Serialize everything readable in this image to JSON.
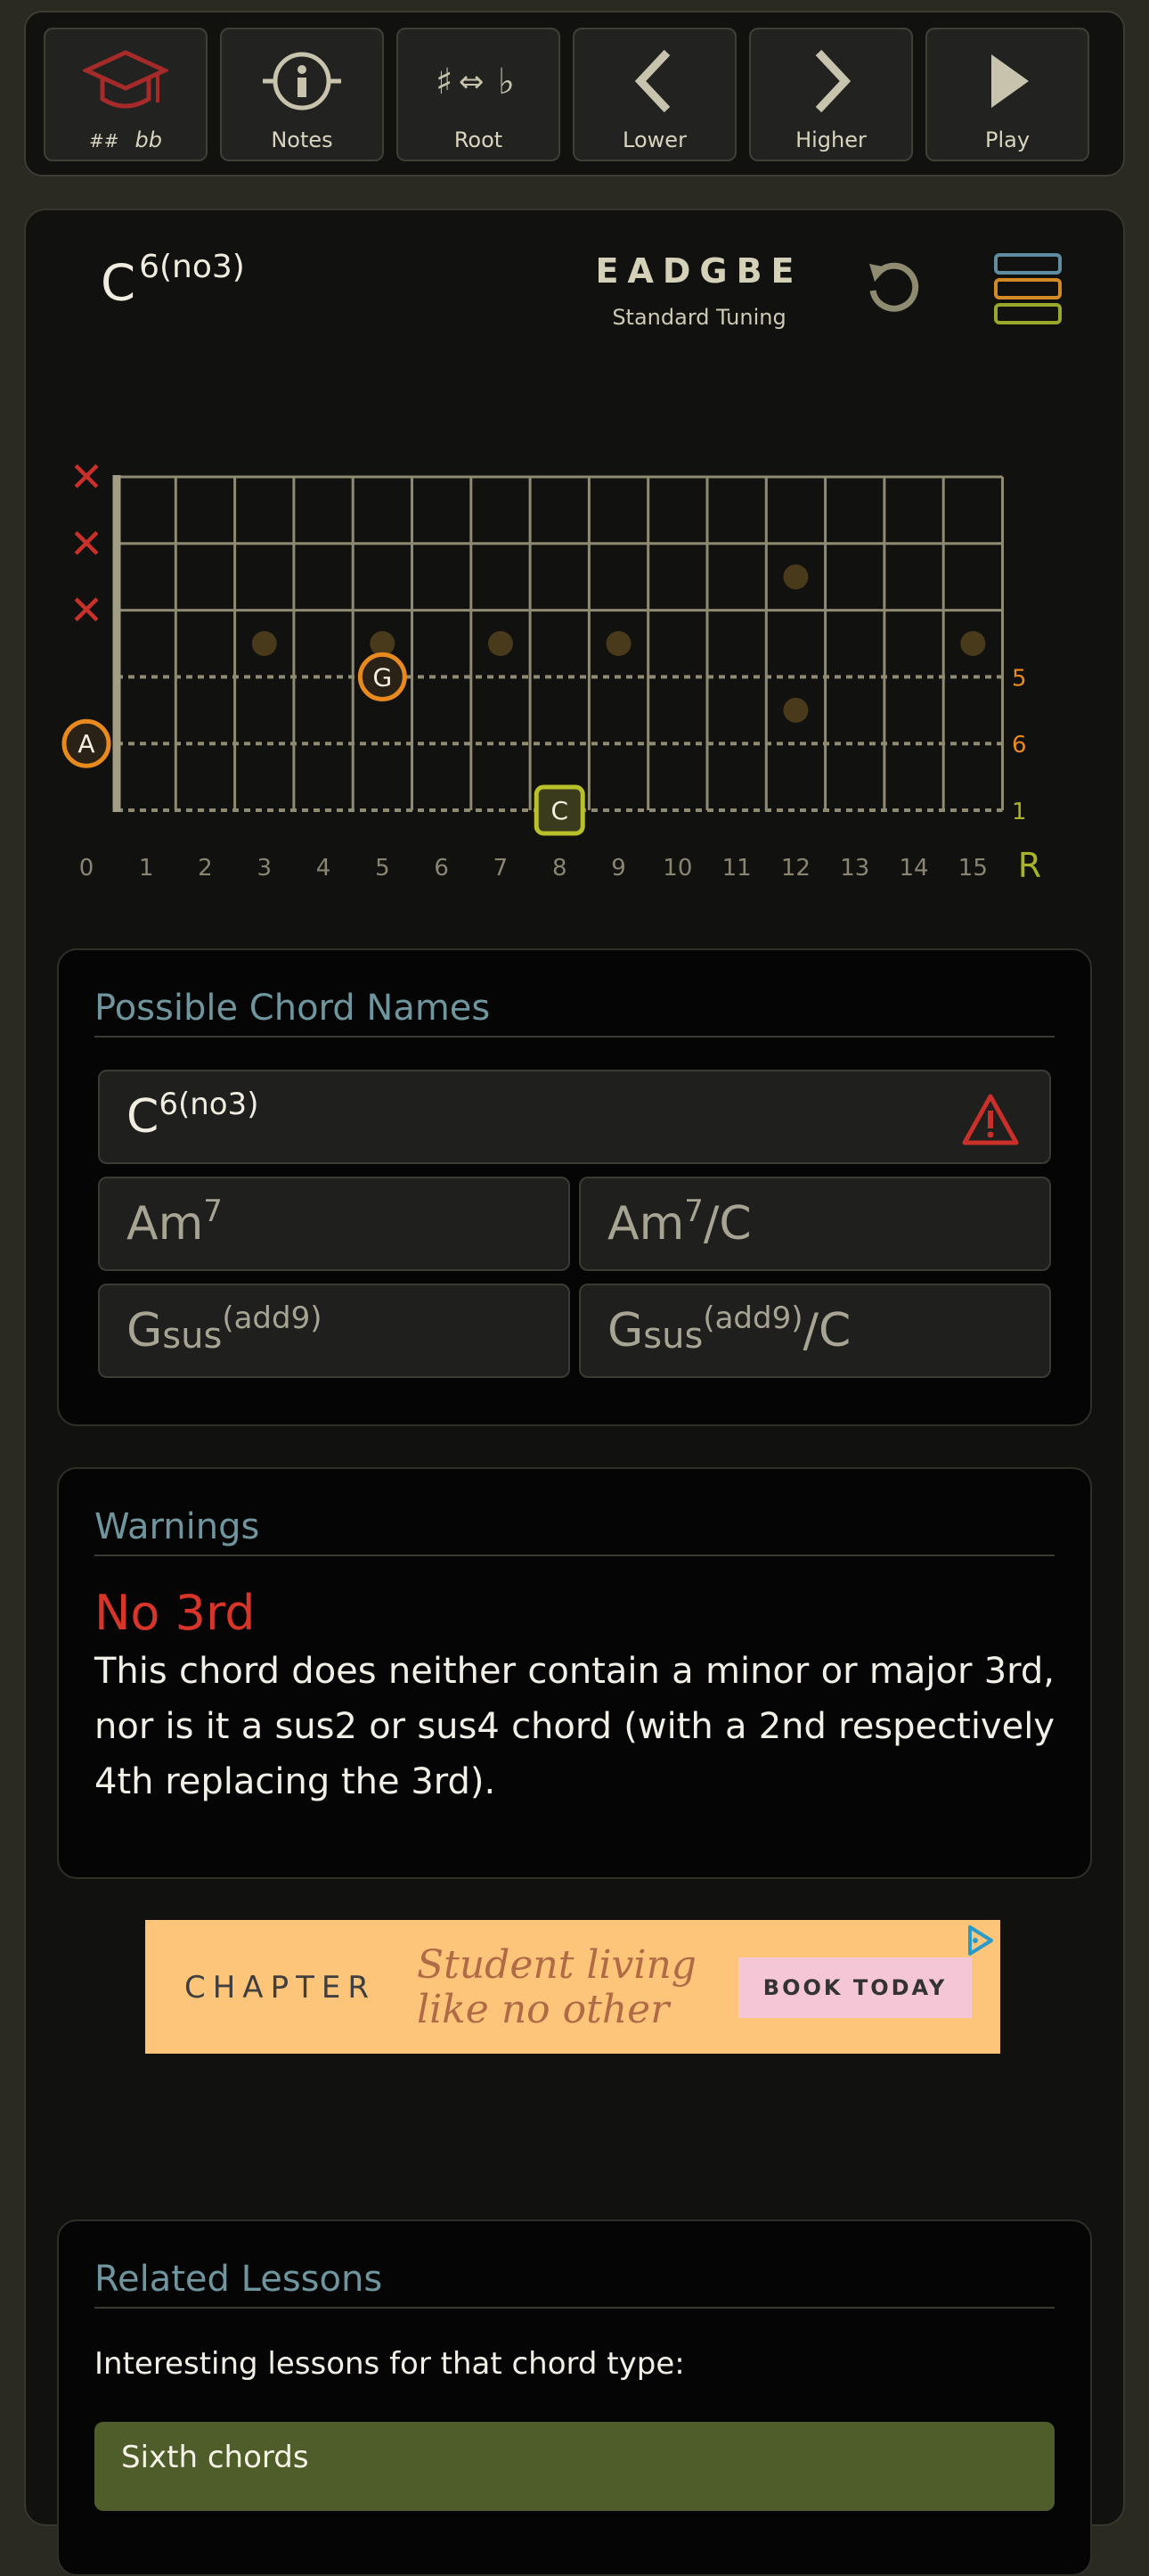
{
  "toolbar": {
    "buttons": [
      {
        "id": "learn",
        "icon": "graduation-cap-icon",
        "label_a": "##",
        "label_b": "bb"
      },
      {
        "id": "notes",
        "icon": "info-icon",
        "label": "Notes"
      },
      {
        "id": "root",
        "icon": "sharp-flat-swap-icon",
        "label": "Root"
      },
      {
        "id": "lower",
        "icon": "chevron-left-icon",
        "label": "Lower"
      },
      {
        "id": "higher",
        "icon": "chevron-right-icon",
        "label": "Higher"
      },
      {
        "id": "play",
        "icon": "play-icon",
        "label": "Play"
      }
    ]
  },
  "chord": {
    "root": "C",
    "extension": "6(no3)",
    "tuning_notes": "EADGBE",
    "tuning_name": "Standard Tuning"
  },
  "fretboard": {
    "muted_strings": [
      "✕",
      "✕",
      "✕"
    ],
    "fret_numbers": [
      "0",
      "1",
      "2",
      "3",
      "4",
      "5",
      "6",
      "7",
      "8",
      "9",
      "10",
      "11",
      "12",
      "13",
      "14",
      "15"
    ],
    "root_marker": "R",
    "inlay_frets": [
      3,
      5,
      7,
      9,
      12,
      15
    ],
    "notes": [
      {
        "string": 4,
        "fret": 5,
        "label": "G",
        "interval": "5",
        "shape": "circle",
        "color": "#e88a1e"
      },
      {
        "string": 5,
        "fret": 0,
        "label": "A",
        "interval": "6",
        "shape": "circle",
        "color": "#e88a1e"
      },
      {
        "string": 6,
        "fret": 8,
        "label": "C",
        "interval": "1",
        "shape": "square",
        "color": "#b8c02a"
      }
    ],
    "colors": {
      "fret": "#8f8a72",
      "nut": "#a29d84",
      "inlay": "#4a3a1c",
      "muted": "#c9302a",
      "interval_orange": "#e88a1e",
      "interval_green": "#a8b425",
      "fret_num": "#8a8572"
    }
  },
  "possible_names": {
    "heading": "Possible Chord Names",
    "main": {
      "root": "C",
      "sup": "6(no3)"
    },
    "alternatives": [
      {
        "root": "Am",
        "sup": "7",
        "suffix": ""
      },
      {
        "root": "Am",
        "sup": "7",
        "suffix": "/C"
      },
      {
        "root": "G",
        "sub": "sus",
        "sup": "(add9)",
        "suffix": ""
      },
      {
        "root": "G",
        "sub": "sus",
        "sup": "(add9)",
        "suffix": "/C"
      }
    ]
  },
  "warnings": {
    "heading": "Warnings",
    "title": "No 3rd",
    "text": "This chord does neither contain a minor or major 3rd, nor is it a sus2 or sus4 chord (with a 2nd respectively 4th replacing the 3rd)."
  },
  "ad": {
    "brand": "CHAPTER",
    "slogan_line1": "Student living",
    "slogan_line2": "like no other",
    "cta": "BOOK TODAY"
  },
  "related_lessons": {
    "heading": "Related Lessons",
    "intro": "Interesting lessons for that chord type:",
    "items": [
      "Sixth chords"
    ]
  }
}
